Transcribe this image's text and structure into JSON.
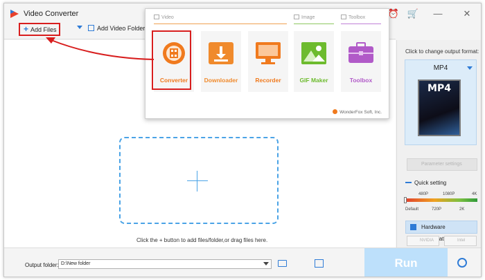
{
  "app": {
    "title": "Video Converter"
  },
  "toolbar": {
    "add_files_label": "Add Files",
    "add_folder_label": "Add Video Folder"
  },
  "main": {
    "hint": "Click the + button to add files/folder,or drag files here."
  },
  "sidebar": {
    "caption": "Click to change output format:",
    "format_name": "MP4",
    "format_tile_text": "MP4",
    "parameter_settings_label": "Parameter settings",
    "quick_setting_label": "Quick setting",
    "scale_top": [
      "480P",
      "1080P",
      "4K"
    ],
    "scale_bottom": [
      "Default",
      "720P",
      "2K"
    ],
    "hw_accel_label": "Hardware acceleration",
    "gpu_options": [
      "NVIDIA",
      "Intel"
    ]
  },
  "bottom": {
    "output_folder_label": "Output folder:",
    "output_folder_value": "D:\\New folder",
    "run_label": "Run"
  },
  "popup": {
    "categories": [
      "Video",
      "Image",
      "Toolbox"
    ],
    "tiles": [
      {
        "label": "Converter",
        "color": "#f07a1e"
      },
      {
        "label": "Downloader",
        "color": "#f08a2c"
      },
      {
        "label": "Recorder",
        "color": "#f07a1e"
      },
      {
        "label": "GIF Maker",
        "color": "#6dbb2e"
      },
      {
        "label": "Toolbox",
        "color": "#b15ac8"
      }
    ],
    "brand": "WonderFox Soft, Inc."
  },
  "colors": {
    "accent": "#2e7bd6",
    "highlight": "#d81e1e",
    "run": "#bde0fb"
  }
}
